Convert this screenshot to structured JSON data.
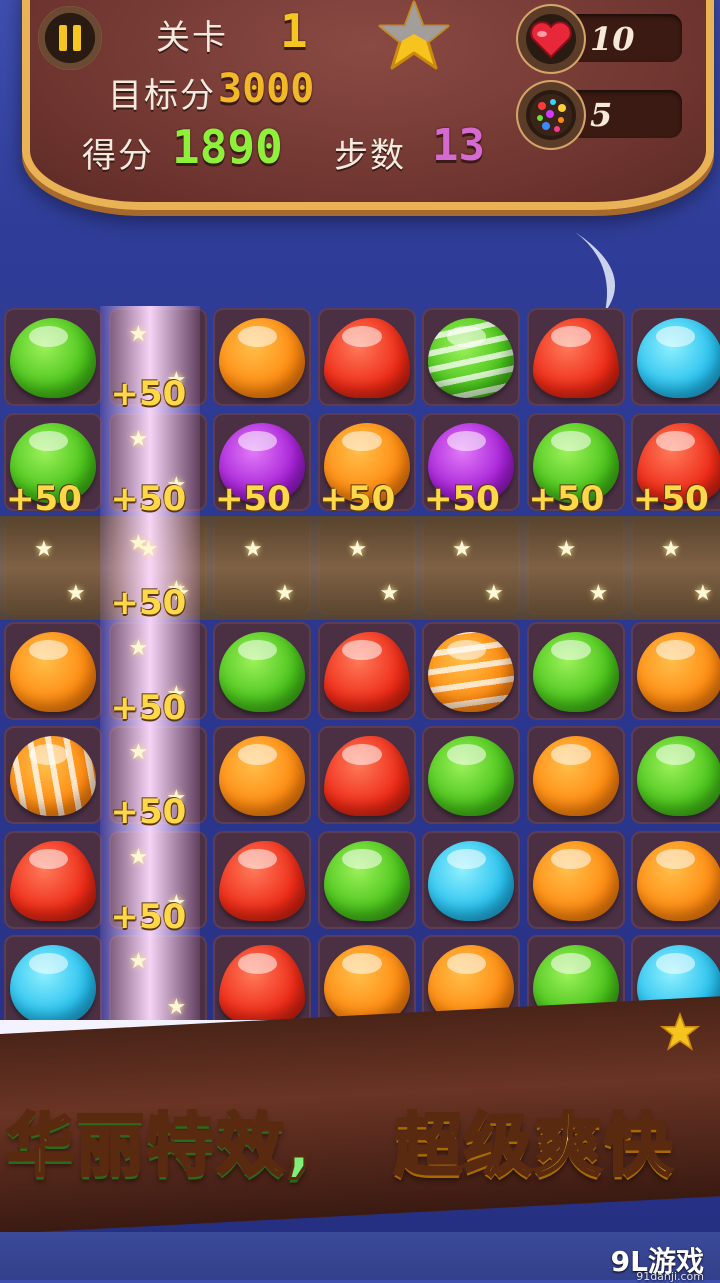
{
  "hud": {
    "level_label": "关卡",
    "level_value": "1",
    "target_label": "目标分",
    "target_value": "3000",
    "score_label": "得分",
    "score_value": "1890",
    "moves_label": "步数",
    "moves_value": "13",
    "lives_value": "10",
    "bombs_value": "5"
  },
  "board": {
    "cols": 7,
    "rows": 7,
    "grid": [
      [
        "green",
        "beam",
        "orange",
        "red",
        "striped-h-green",
        "red",
        "blue"
      ],
      [
        "green",
        "beam",
        "purple",
        "orange",
        "purple",
        "green",
        "red"
      ],
      [
        "beam",
        "beam",
        "beam",
        "beam",
        "beam",
        "beam",
        "beam"
      ],
      [
        "orange",
        "beam",
        "green",
        "red",
        "striped-h-orange",
        "green",
        "orange"
      ],
      [
        "striped-v-orange",
        "beam",
        "orange",
        "red",
        "green",
        "orange",
        "green"
      ],
      [
        "red",
        "beam",
        "red",
        "green",
        "blue",
        "orange",
        "orange"
      ],
      [
        "blue",
        "beam",
        "red",
        "orange",
        "orange",
        "green",
        "blue"
      ]
    ],
    "score_popups": [
      {
        "text": "+50",
        "row": 0,
        "col": 1
      },
      {
        "text": "+50",
        "row": 1,
        "col": 0
      },
      {
        "text": "+50",
        "row": 1,
        "col": 1
      },
      {
        "text": "+50",
        "row": 1,
        "col": 2
      },
      {
        "text": "+50",
        "row": 1,
        "col": 3
      },
      {
        "text": "+50",
        "row": 1,
        "col": 4
      },
      {
        "text": "+50",
        "row": 1,
        "col": 5
      },
      {
        "text": "+50",
        "row": 1,
        "col": 6
      },
      {
        "text": "+50",
        "row": 2,
        "col": 1
      },
      {
        "text": "+50",
        "row": 3,
        "col": 1
      },
      {
        "text": "+50",
        "row": 4,
        "col": 1
      },
      {
        "text": "+50",
        "row": 5,
        "col": 1
      }
    ]
  },
  "banner": {
    "slogan_left": "华丽特效,",
    "slogan_right": "超级爽快"
  },
  "watermark": {
    "brand": "9L游戏",
    "url": "91danji.com"
  },
  "colors": {
    "panel_bg": "#6e342f",
    "panel_border": "#e9b255",
    "level_number": "#f6c520",
    "target_number": "#f3b826",
    "score_number": "#8ef03a",
    "moves_number": "#d56ad0"
  }
}
